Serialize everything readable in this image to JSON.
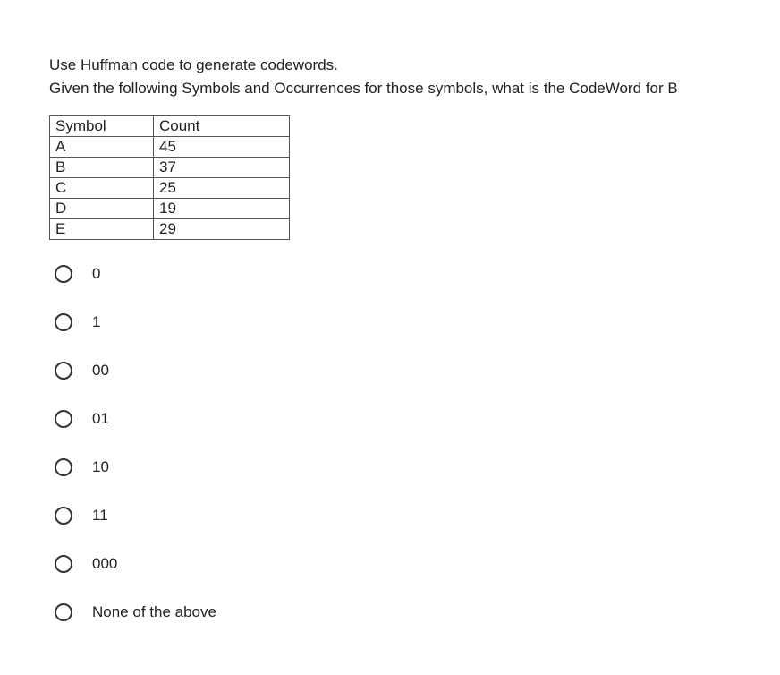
{
  "question": {
    "line1": "Use Huffman code to generate codewords.",
    "line2": "Given the following Symbols and Occurrences for those symbols, what is the CodeWord for B"
  },
  "table": {
    "headers": {
      "symbol": "Symbol",
      "count": "Count"
    },
    "rows": [
      {
        "symbol": "A",
        "count": "45"
      },
      {
        "symbol": "B",
        "count": "37"
      },
      {
        "symbol": "C",
        "count": "25"
      },
      {
        "symbol": "D",
        "count": "19"
      },
      {
        "symbol": "E",
        "count": "29"
      }
    ]
  },
  "options": [
    {
      "label": "0"
    },
    {
      "label": "1"
    },
    {
      "label": "00"
    },
    {
      "label": "01"
    },
    {
      "label": "10"
    },
    {
      "label": "11"
    },
    {
      "label": "000"
    },
    {
      "label": "None of the above"
    }
  ]
}
